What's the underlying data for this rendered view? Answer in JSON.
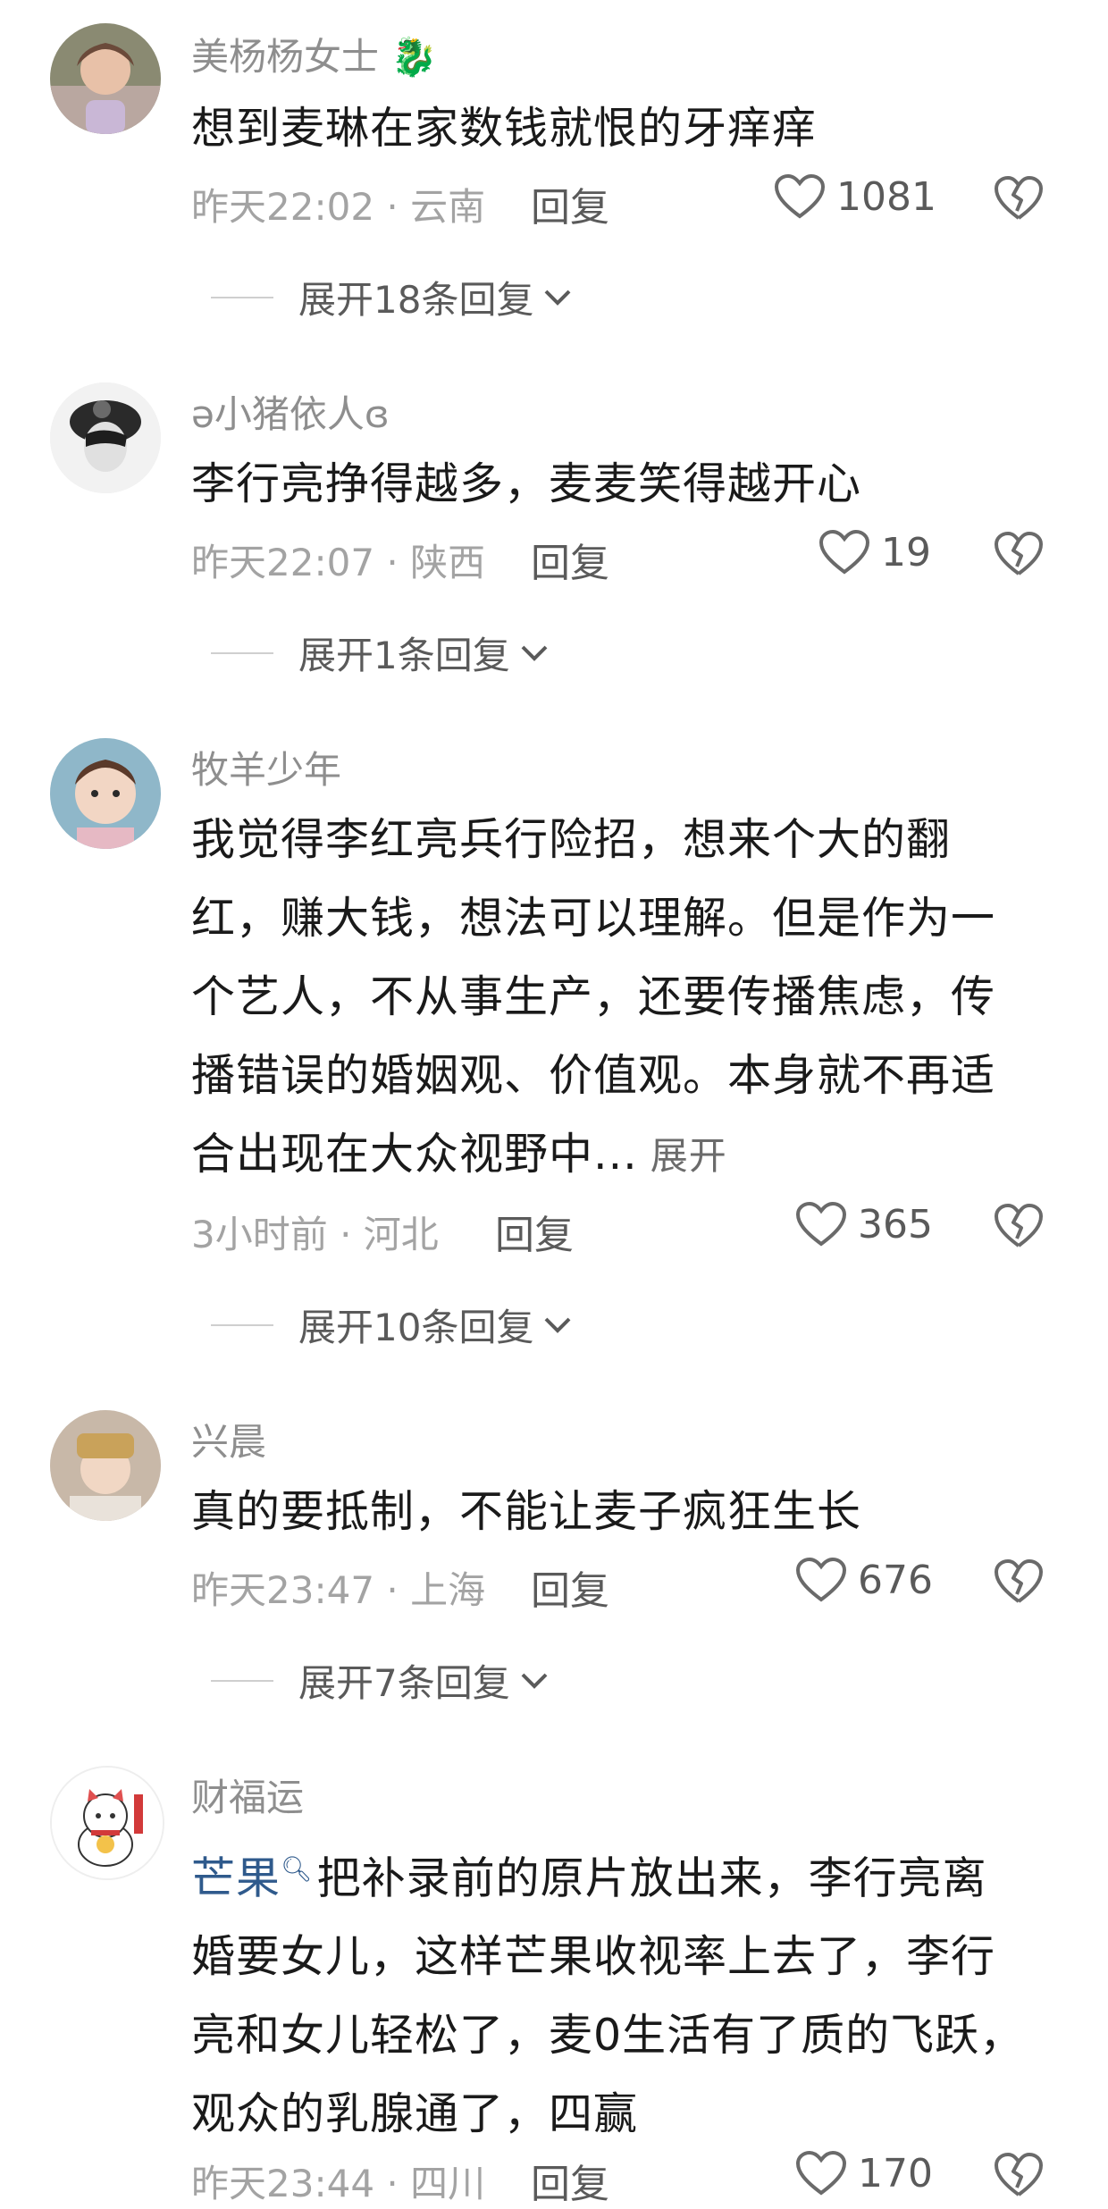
{
  "comments": [
    {
      "username": "美杨杨女士",
      "text": "想到麦琳在家数钱就恨的牙痒痒",
      "time": "昨天22:02",
      "location": "云南",
      "reply_label": "回复",
      "likes": "1081",
      "expand_label": "展开18条回复"
    },
    {
      "username": "ə小猪依人ɞ",
      "text": "李行亮挣得越多，麦麦笑得越开心",
      "time": "昨天22:07",
      "location": "陕西",
      "reply_label": "回复",
      "likes": "19",
      "expand_label": "展开1条回复"
    },
    {
      "username": "牧羊少年",
      "text_lines": [
        "我觉得李红亮兵行险招，想来个大的翻",
        "红，赚大钱，想法可以理解。但是作为一",
        "个艺人，不从事生产，还要传播焦虑，传",
        "播错误的婚姻观、价值观。本身就不再适",
        "合出现在大众视野中..."
      ],
      "expand_inline": "展开",
      "time": "3小时前",
      "location": "河北",
      "reply_label": "回复",
      "likes": "365",
      "expand_label": "展开10条回复"
    },
    {
      "username": "兴晨",
      "text": "真的要抵制，不能让麦子疯狂生长",
      "time": "昨天23:47",
      "location": "上海",
      "reply_label": "回复",
      "likes": "676",
      "expand_label": "展开7条回复"
    },
    {
      "username": "财福运",
      "mention": "芒果",
      "text_first": "把补录前的原片放出来，李行亮离",
      "text_lines": [
        "婚要女儿，这样芒果收视率上去了，李行",
        "亮和女儿轻松了，麦0生活有了质的飞跃，",
        "观众的乳腺通了，四赢"
      ],
      "time": "昨天23:44",
      "location": "四川",
      "reply_label": "回复",
      "likes": "170"
    }
  ],
  "separator": " · ",
  "colors": {
    "meta": "#a3a3a3",
    "text": "#1a1a1a",
    "mention": "#2f5a8c"
  }
}
